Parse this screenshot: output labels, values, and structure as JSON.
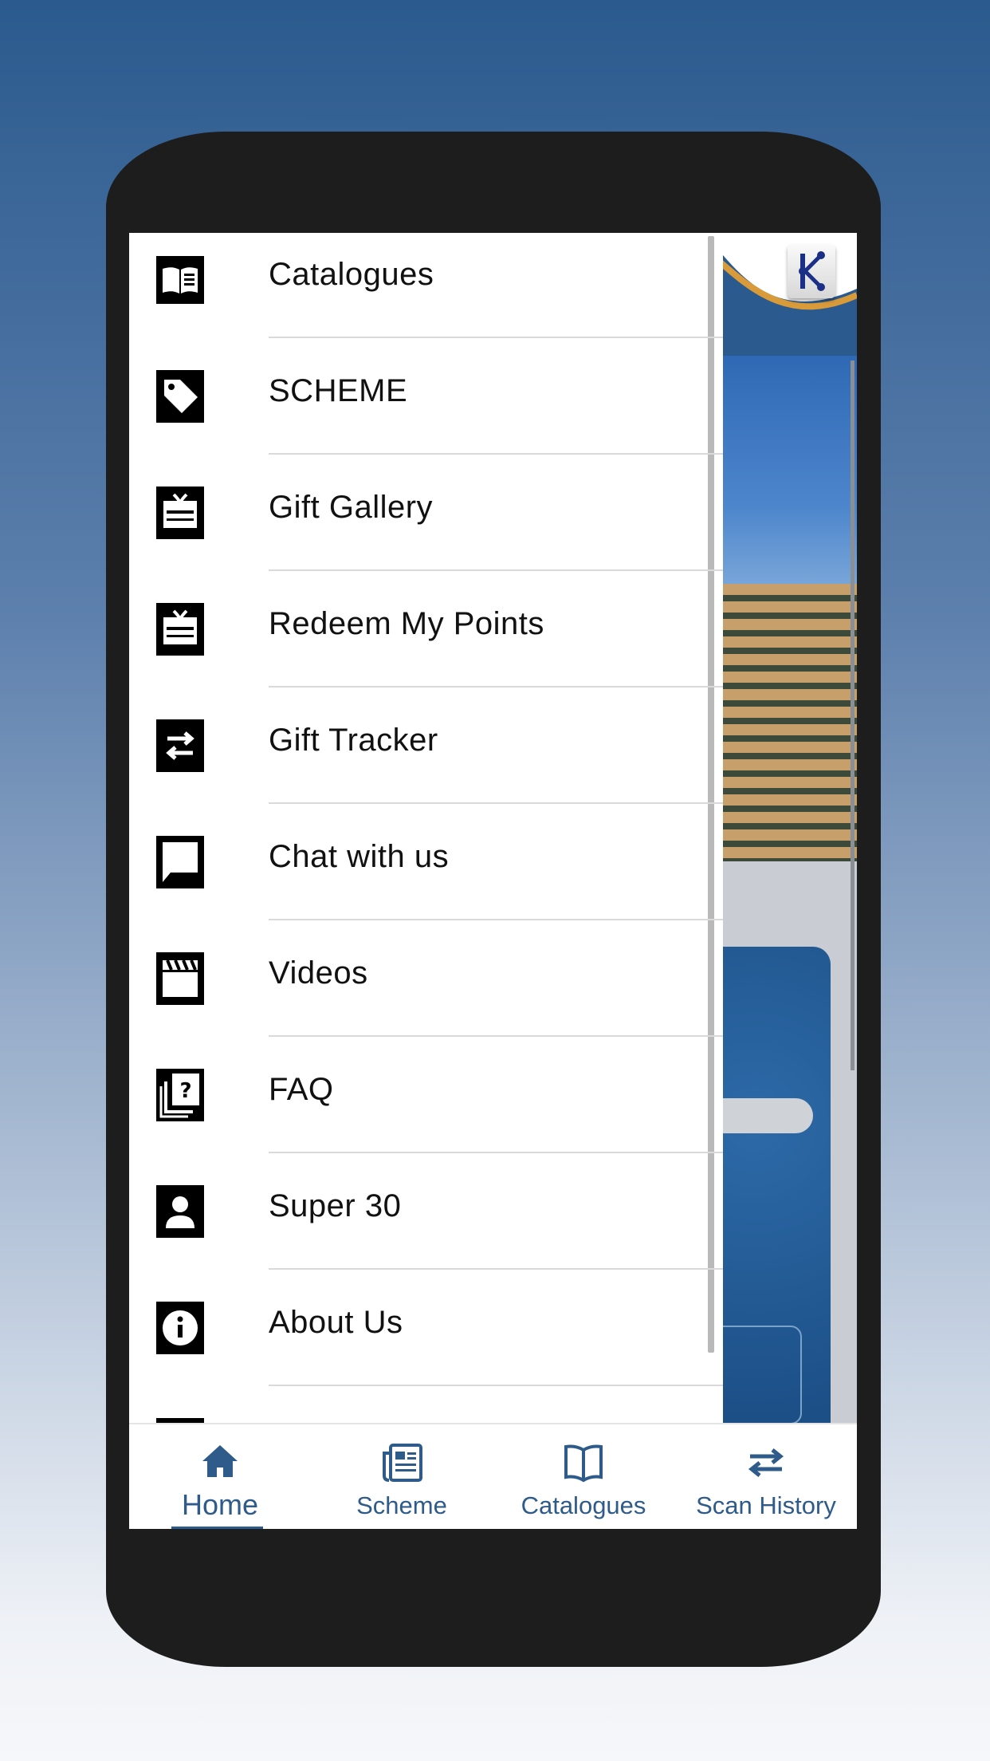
{
  "drawer": {
    "items": [
      {
        "label": "Catalogues",
        "icon": "book-icon"
      },
      {
        "label": "SCHEME",
        "icon": "tag-icon"
      },
      {
        "label": "Gift Gallery",
        "icon": "gift-card-icon"
      },
      {
        "label": "Redeem My Points",
        "icon": "gift-card-icon"
      },
      {
        "label": "Gift Tracker",
        "icon": "swap-arrows-icon"
      },
      {
        "label": "Chat with us",
        "icon": "chat-bubble-icon"
      },
      {
        "label": "Videos",
        "icon": "clapperboard-icon"
      },
      {
        "label": "FAQ",
        "icon": "question-library-icon"
      },
      {
        "label": "Super 30",
        "icon": "person-icon"
      },
      {
        "label": "About Us",
        "icon": "info-icon"
      }
    ]
  },
  "bottom_nav": {
    "items": [
      {
        "label": "Home",
        "icon": "home-icon",
        "active": true
      },
      {
        "label": "Scheme",
        "icon": "newspaper-icon",
        "active": false
      },
      {
        "label": "Catalogues",
        "icon": "open-book-icon",
        "active": false
      },
      {
        "label": "Scan History",
        "icon": "swap-arrows-icon",
        "active": false
      }
    ]
  },
  "colors": {
    "nav_accent": "#2e5b8a",
    "header_wave": "#2b5a8e",
    "header_wave_accent": "#d99a3a"
  }
}
